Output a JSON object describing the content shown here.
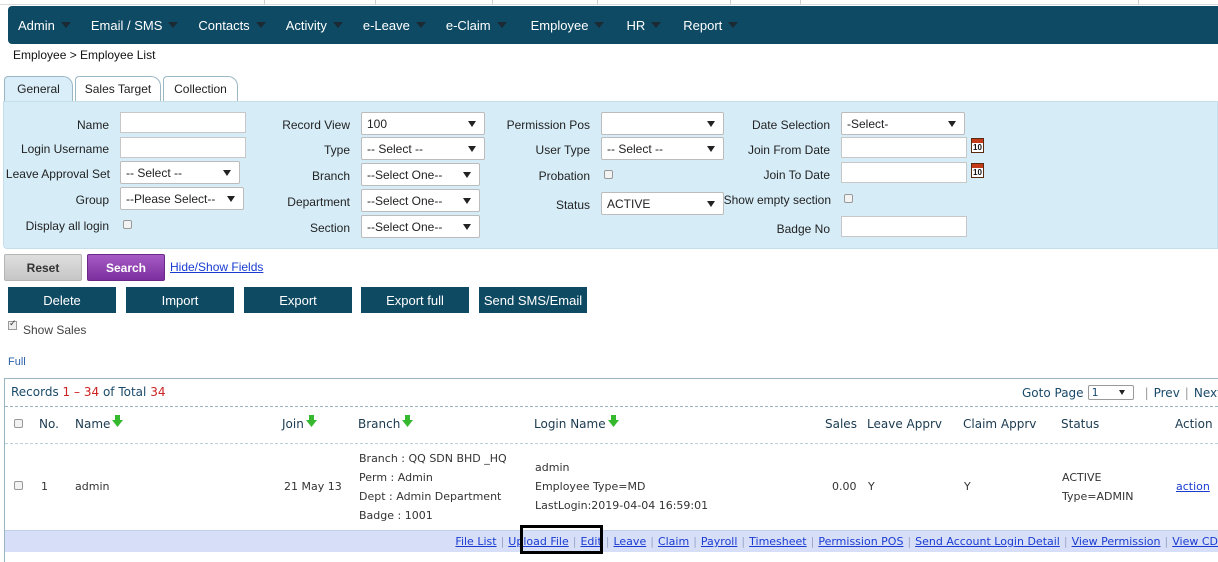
{
  "nav": {
    "items": [
      "Admin",
      "Email / SMS",
      "Contacts",
      "Activity",
      "e-Leave",
      "e-Claim",
      "Employee",
      "HR",
      "Report"
    ]
  },
  "breadcrumb": "Employee > Employee List",
  "tabs": [
    "General",
    "Sales Target",
    "Collection"
  ],
  "filters": {
    "name_label": "Name",
    "login_username_label": "Login Username",
    "leave_approval_set_label": "Leave Approval Set",
    "leave_approval_set_value": "-- Select --",
    "group_label": "Group",
    "group_value": "--Please Select--",
    "display_all_login_label": "Display all login",
    "record_view_label": "Record View",
    "record_view_value": "100",
    "type_label": "Type",
    "type_value": "-- Select --",
    "branch_label": "Branch",
    "branch_value": "--Select One--",
    "department_label": "Department",
    "department_value": "--Select One--",
    "section_label": "Section",
    "section_value": "--Select One--",
    "permission_pos_label": "Permission Pos",
    "permission_pos_value": "",
    "user_type_label": "User Type",
    "user_type_value": "-- Select --",
    "probation_label": "Probation",
    "status_label": "Status",
    "status_value": "ACTIVE",
    "date_selection_label": "Date Selection",
    "date_selection_value": "-Select-",
    "join_from_date_label": "Join From Date",
    "join_to_date_label": "Join To Date",
    "show_empty_section_label": "Show empty section",
    "badge_no_label": "Badge No",
    "calendar_icon_text": "10"
  },
  "buttons": {
    "reset": "Reset",
    "search": "Search",
    "hide_show_fields": "Hide/Show Fields",
    "delete": "Delete",
    "import": "Import",
    "export": "Export",
    "export_full": "Export full",
    "send_sms_email": "Send SMS/Email"
  },
  "show_sales_label": "Show Sales",
  "full_link": "Full",
  "records": {
    "label": "Records",
    "from": "1",
    "dash": "–",
    "to": "34",
    "of_total": "of Total",
    "total": "34",
    "goto_page_label": "Goto Page",
    "goto_page_value": "1",
    "prev": "Prev",
    "next": "Next"
  },
  "table": {
    "headers": {
      "no": "No.",
      "name": "Name",
      "join": "Join",
      "branch": "Branch",
      "login_name": "Login Name",
      "sales": "Sales",
      "leave_apprv": "Leave Apprv",
      "claim_apprv": "Claim Apprv",
      "status": "Status",
      "action": "Action"
    },
    "row": {
      "no": "1",
      "name": "admin",
      "join": "21 May 13",
      "branch_line1": "Branch : QQ SDN BHD _HQ",
      "branch_line2": "Perm : Admin",
      "branch_line3": "Dept : Admin Department",
      "branch_line4": "Badge : 1001",
      "login_line1": "admin",
      "login_line2": "Employee Type=MD",
      "login_line3": "LastLogin:2019-04-04 16:59:01",
      "sales": "0.00",
      "leave_apprv": "Y",
      "claim_apprv": "Y",
      "status_line1": "ACTIVE",
      "status_line2": "Type=ADMIN",
      "action": "action"
    },
    "row_actions": [
      "File List",
      "Upload File",
      "Edit",
      "Leave",
      "Claim",
      "Payroll",
      "Timesheet",
      "Permission POS",
      "Send Account Login Detail",
      "View Permission",
      "View CD"
    ]
  },
  "colors": {
    "nav_bg": "#0e4a63",
    "filter_bg": "#d6edf8",
    "action_btn_bg": "#0f4a63",
    "search_btn": "#8b3db0",
    "sort_arrow": "#36b82f",
    "red_count": "#cc2222"
  }
}
